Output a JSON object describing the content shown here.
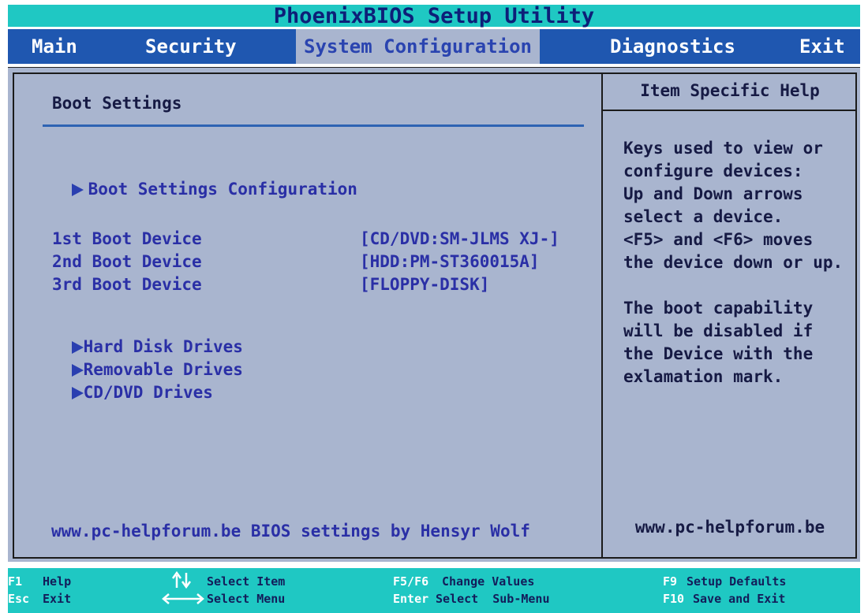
{
  "app_title": "PhoenixBIOS Setup Utility",
  "menu": {
    "items": [
      "Main",
      "Security",
      "System Configuration",
      "Diagnostics",
      "Exit"
    ],
    "active": "System Configuration"
  },
  "main_panel": {
    "section_title": "Boot Settings",
    "submenus": {
      "boot_settings_configuration": "Boot Settings Configuration",
      "hard_disk_drives": "Hard Disk Drives",
      "removable_drives": "Removable Drives",
      "cd_dvd_drives": "CD/DVD Drives"
    },
    "boot_devices": [
      {
        "label": "1st Boot Device",
        "value": "[CD/DVD:SM-JLMS XJ-]"
      },
      {
        "label": "2nd Boot Device",
        "value": "[HDD:PM-ST360015A]"
      },
      {
        "label": "3rd Boot Device",
        "value": "[FLOPPY-DISK]"
      }
    ],
    "footer_text": "www.pc-helpforum.be BIOS settings by Hensyr Wolf"
  },
  "help_panel": {
    "title": "Item Specific Help",
    "paragraph1": "Keys used to view or\nconfigure devices:\nUp and Down arrows\nselect a device.\n<F5> and <F6> moves\nthe device down or up.",
    "paragraph2": "The boot capability\nwill be disabled if\nthe Device with the\nexlamation mark.",
    "footer_text": "www.pc-helpforum.be"
  },
  "statusbar": {
    "f1_key": "F1",
    "f1_label": "Help",
    "esc_key": "Esc",
    "esc_label": "Exit",
    "updown_label": "Select Item",
    "leftright_label": "Select Menu",
    "f5f6_key": "F5/F6",
    "f5f6_label": "Change Values",
    "enter_key": "Enter",
    "enter_label": "Select  Sub-Menu",
    "f9_key": "F9",
    "f9_label": "Setup Defaults",
    "f10_key": "F10",
    "f10_label": "Save and Exit"
  },
  "colors": {
    "titlebar": "#1fc8c3",
    "menubar": "#1f57b0",
    "panel": "#a9b5cf",
    "accent_text": "#2a2fa6"
  },
  "icons": {
    "submenu_marker": "triangle-right-icon",
    "up_down_arrows": "up-down-arrows-icon",
    "left_right_arrows": "left-right-arrows-icon"
  }
}
